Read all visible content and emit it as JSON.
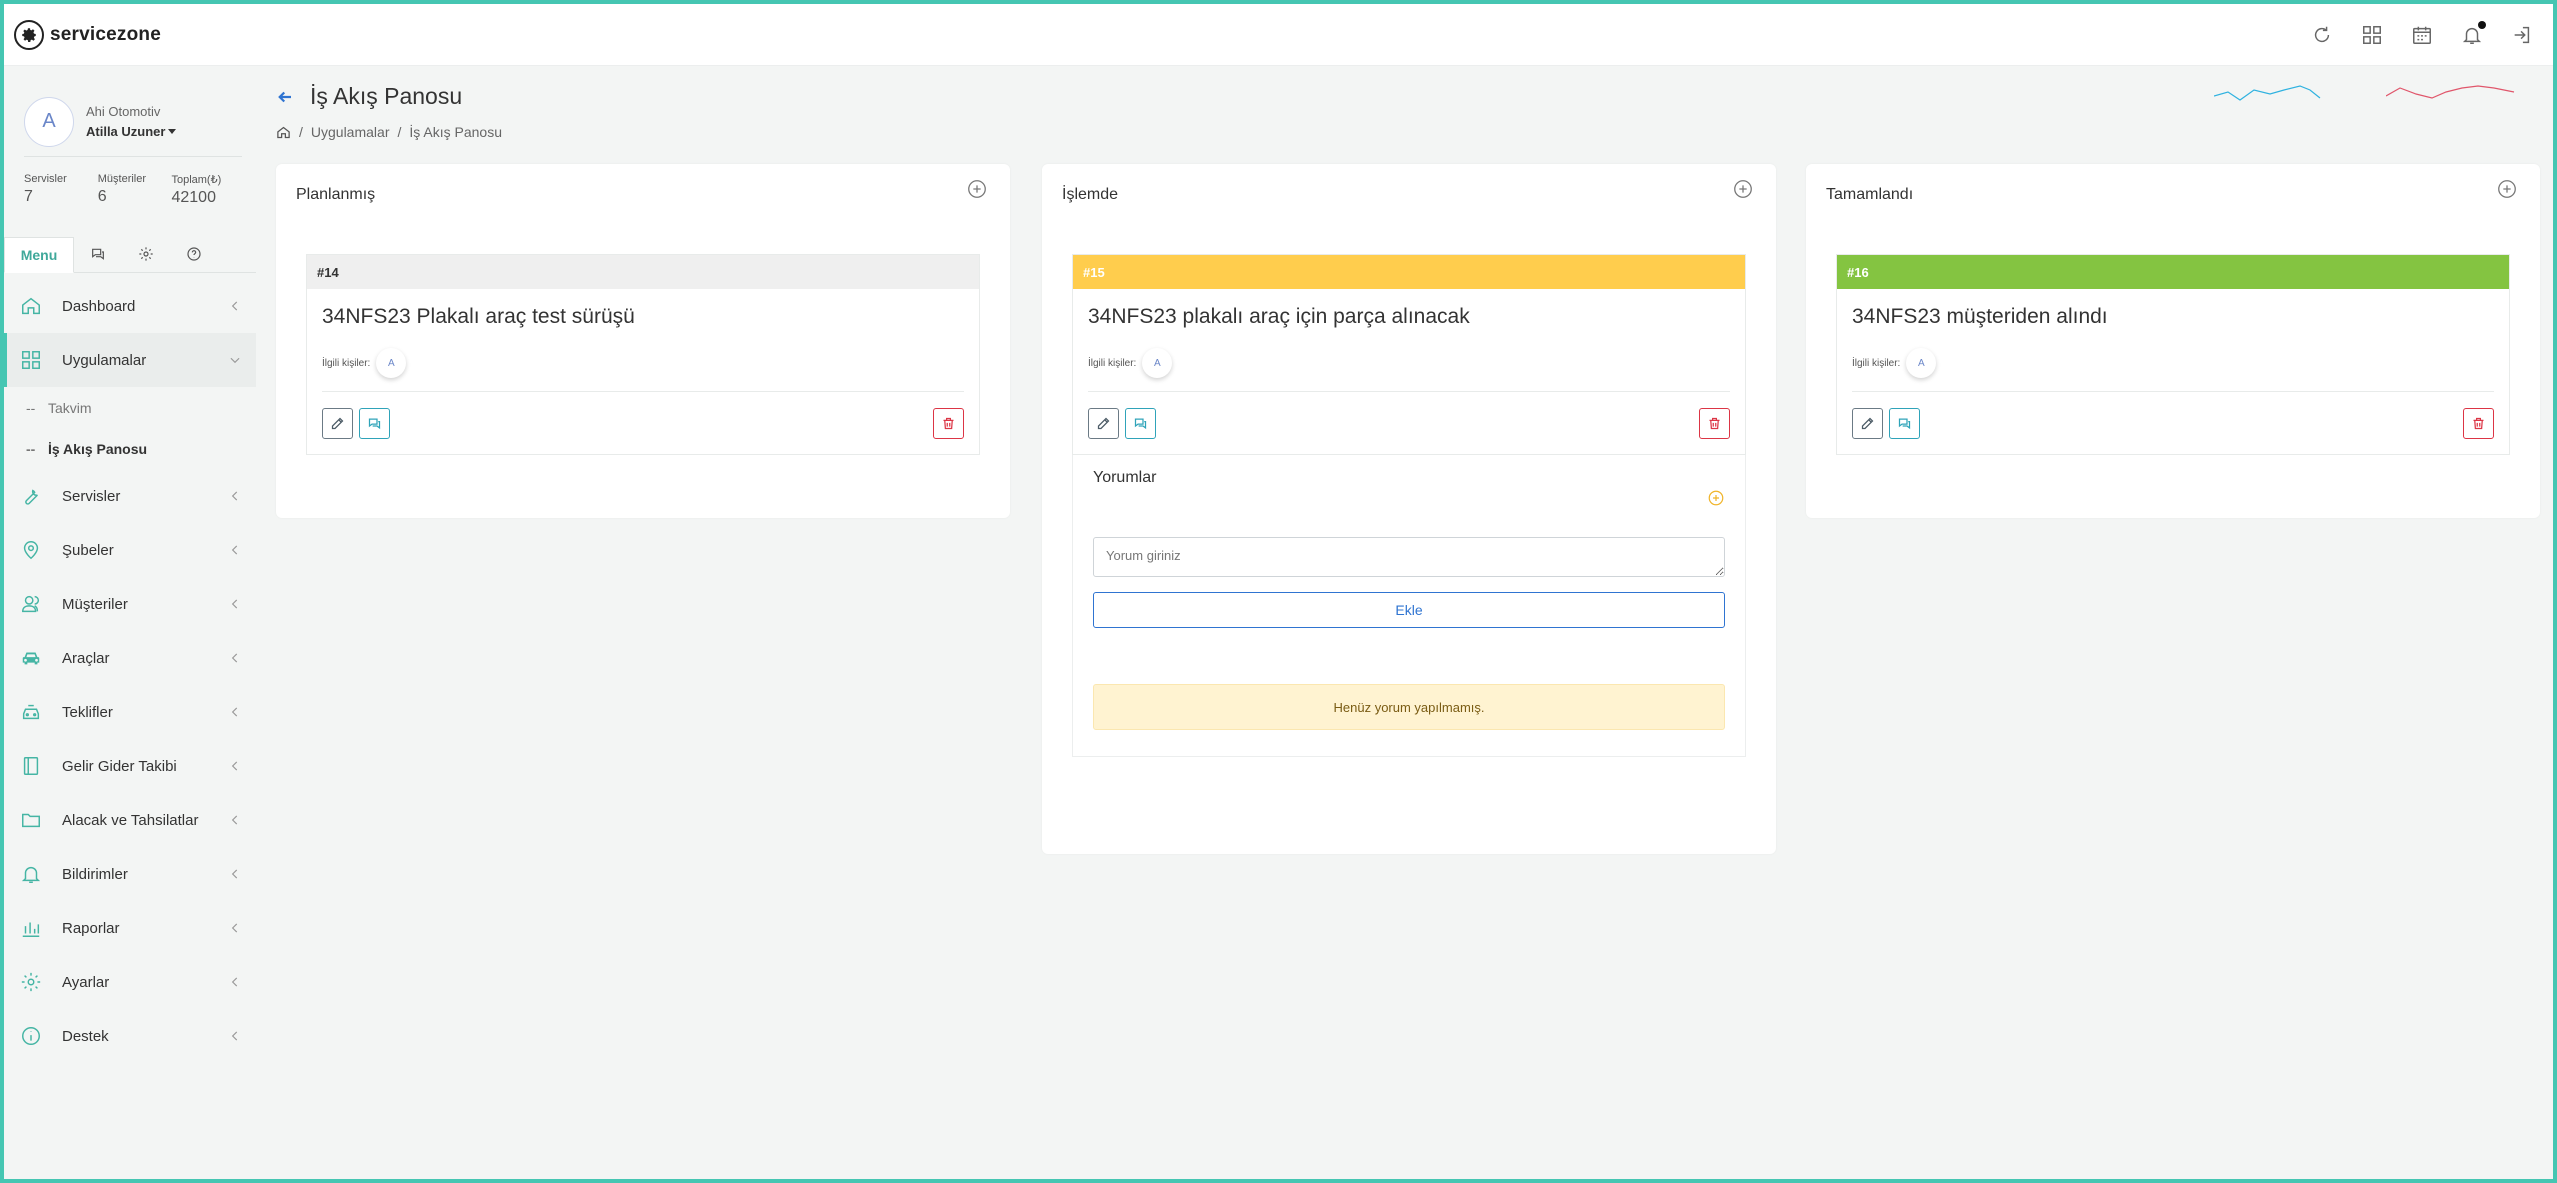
{
  "brand": {
    "name": "servicezone"
  },
  "user": {
    "avatar_letter": "A",
    "company": "Ahi Otomotiv",
    "name": "Atilla Uzuner"
  },
  "stats": [
    {
      "label": "Servisler",
      "value": "7"
    },
    {
      "label": "Müşteriler",
      "value": "6"
    },
    {
      "label": "Toplam(₺)",
      "value": "42100"
    }
  ],
  "tabs": {
    "menu_label": "Menu"
  },
  "nav": {
    "dashboard": "Dashboard",
    "uygulamalar": "Uygulamalar",
    "takvim": "Takvim",
    "is_akis": "İş Akış Panosu",
    "servisler": "Servisler",
    "subeler": "Şubeler",
    "musteriler": "Müşteriler",
    "araclar": "Araçlar",
    "teklifler": "Teklifler",
    "gelir_gider": "Gelir Gider Takibi",
    "alacak": "Alacak ve Tahsilatlar",
    "bildirimler": "Bildirimler",
    "raporlar": "Raporlar",
    "ayarlar": "Ayarlar",
    "destek": "Destek"
  },
  "page": {
    "title": "İş Akış Panosu",
    "breadcrumb": [
      "Uygulamalar",
      "İş Akış Panosu"
    ],
    "sep": "/"
  },
  "columns": [
    {
      "title": "Planlanmış",
      "card": {
        "id": "#14",
        "title": "34NFS23 Plakalı araç test sürüşü",
        "people_label": "İlgili kişiler:",
        "person": "A",
        "color": "#efefef"
      }
    },
    {
      "title": "İşlemde",
      "card": {
        "id": "#15",
        "title": "34NFS23 plakalı araç için parça alınacak",
        "people_label": "İlgili kişiler:",
        "person": "A",
        "color": "#ffcd4d"
      }
    },
    {
      "title": "Tamamlandı",
      "card": {
        "id": "#16",
        "title": "34NFS23 müşteriden alındı",
        "people_label": "İlgili kişiler:",
        "person": "A",
        "color": "#84c441"
      }
    }
  ],
  "comments": {
    "title": "Yorumlar",
    "placeholder": "Yorum giriniz",
    "add_label": "Ekle",
    "empty": "Henüz yorum yapılmamış."
  },
  "colors": {
    "accent": "#45c6b2",
    "primary": "#2f74d1",
    "danger": "#dc3545"
  },
  "icons": [
    "refresh-icon",
    "apps-grid-icon",
    "calendar-icon",
    "bell-icon",
    "logout-icon"
  ]
}
